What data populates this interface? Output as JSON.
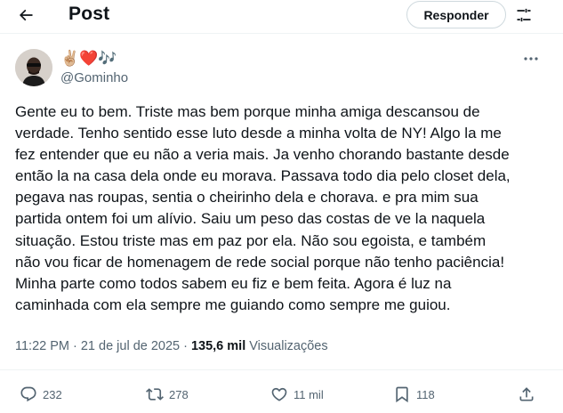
{
  "header": {
    "title": "Post",
    "reply_button": "Responder"
  },
  "author": {
    "display_name_emojis": "✌🏼❤️🎶",
    "handle": "@Gominho"
  },
  "tweet": {
    "lines": [
      "Gente eu to bem. Triste mas bem porque minha amiga descansou de",
      "verdade. Tenho sentido esse luto desde a minha volta de NY! Algo la me",
      "fez entender que eu não a veria mais. Ja venho chorando bastante desde",
      "então la na casa dela onde eu morava. Passava todo dia pelo closet dela,",
      "pegava nas roupas, sentia o cheirinho dela e chorava. e pra mim sua",
      "partida ontem foi um alívio. Saiu um peso das costas de ve la naquela",
      "situação. Estou triste mas em paz por ela. Não sou egoista, e também",
      "não vou ficar de homenagem de rede social porque não tenho paciência!",
      "Minha parte como todos sabem eu fiz e bem feita. Agora é luz na",
      "caminhada com ela sempre me guiando como sempre me guiou."
    ]
  },
  "meta": {
    "time": "11:22 PM",
    "separator": "·",
    "date": "21 de jul de 2025",
    "views_count": "135,6 mil",
    "views_label": "Visualizações"
  },
  "actions": {
    "replies": "232",
    "reposts": "278",
    "likes": "11 mil",
    "bookmarks": "118"
  },
  "colors": {
    "text": "#0f1419",
    "secondary": "#536471",
    "border": "#eff3f4"
  }
}
